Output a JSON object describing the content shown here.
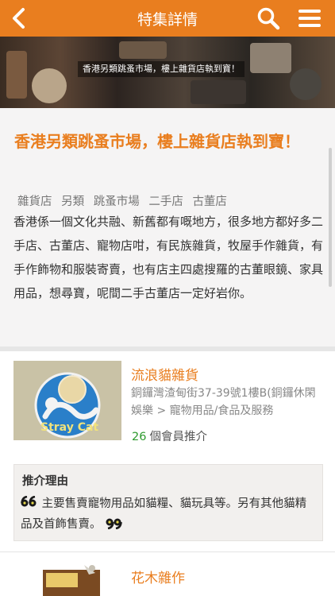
{
  "header": {
    "title": "特集詳情",
    "back_icon": "chevron-left-icon",
    "search_icon": "search-icon",
    "menu_icon": "hamburger-menu-icon",
    "bar_color": "#e97e1f"
  },
  "banner": {
    "caption": "香港另類跳蚤市場，樓上雜貨店執到寶！"
  },
  "article": {
    "title": "香港另類跳蚤市場，樓上雜貨店執到寶！",
    "tags": [
      "雜貨店",
      "另類",
      "跳蚤市場",
      "二手店",
      "古董店"
    ],
    "body": "香港係一個文化共融、新舊都有嘅地方，很多地方都好多二手店、古董店、寵物店咁，有民族雜貨，牧屋手作雜貨，有手作飾物和服裝寄賣，也有店主四處搜羅的古董眼鏡、家具用品，想尋寶，呢間二手古董店一定好岩你。"
  },
  "shops": [
    {
      "name": "流浪貓雜貨",
      "address": "銅鑼灣渣甸街37-39號1樓B(銅鑼休閑娛樂 > 寵物用品/食品及服務",
      "recommend_count": "26",
      "recommend_label": "個會員推介",
      "image_text": "Stray Cat",
      "reason_title": "推介理由",
      "reason_text": "主要售賣寵物用品如貓糧、貓玩具等。另有其他貓精品及首飾售賣。"
    },
    {
      "name": "花木雜作"
    }
  ],
  "colors": {
    "accent": "#e97e1f",
    "recommend_count": "#2e9a2e"
  }
}
